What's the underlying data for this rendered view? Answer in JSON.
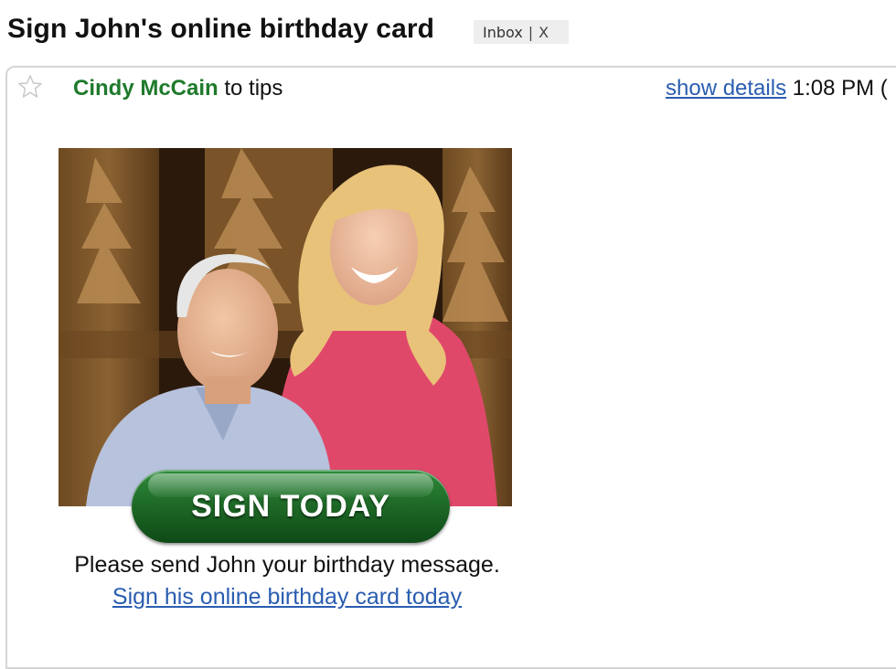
{
  "email": {
    "subject": "Sign John's online birthday card",
    "labels": [
      {
        "text": "Inbox",
        "remove": "X"
      }
    ],
    "from_name": "Cindy McCain",
    "recipient_text": "to tips",
    "show_details": "show details",
    "time": "1:08 PM ("
  },
  "body": {
    "photo_icon": "portrait-photo-icon",
    "button_label": "SIGN TODAY",
    "message": "Please send John your birthday message.",
    "link_text": "Sign his online birthday card today"
  },
  "colors": {
    "sender": "#1f7a2c",
    "link": "#2a5db0",
    "button": "#1f6b28"
  }
}
